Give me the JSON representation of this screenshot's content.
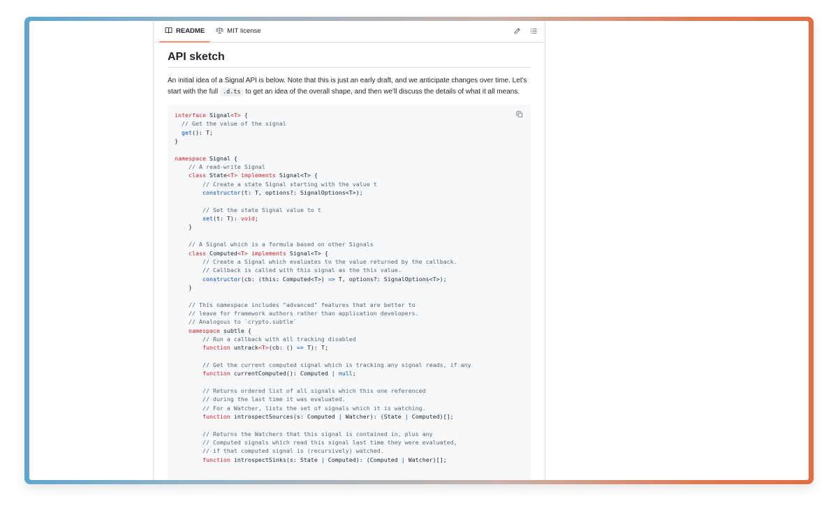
{
  "tabs": [
    {
      "label": "README",
      "icon": "book-icon",
      "active": true
    },
    {
      "label": "MIT license",
      "icon": "scale-icon",
      "active": false
    }
  ],
  "actions": [
    {
      "icon": "pencil-icon",
      "label": "Edit file"
    },
    {
      "icon": "list-icon",
      "label": "Outline"
    }
  ],
  "heading": "API sketch",
  "paragraph": {
    "before": "An initial idea of a Signal API is below. Note that this is just an early draft, and we anticipate changes over time. Let's start with the full ",
    "code": ".d.ts",
    "after": " to get an idea of the overall shape, and then we'll discuss the details of what it all means."
  },
  "code_lines": [
    [
      [
        "kw",
        "interface"
      ],
      [
        "tx",
        " Signal"
      ],
      [
        "kw",
        "<T>"
      ],
      [
        "tx",
        " {"
      ]
    ],
    [
      [
        "cm",
        "  // Get the value of the signal"
      ]
    ],
    [
      [
        "fn",
        "  get"
      ],
      [
        "tx",
        "(): T;"
      ]
    ],
    [
      [
        "tx",
        "}"
      ]
    ],
    [],
    [
      [
        "kw",
        "namespace"
      ],
      [
        "tx",
        " Signal {"
      ]
    ],
    [
      [
        "cm",
        "    // A read-write Signal"
      ]
    ],
    [
      [
        "kw",
        "    class"
      ],
      [
        "tx",
        " State"
      ],
      [
        "kw",
        "<T>"
      ],
      [
        "tx",
        " "
      ],
      [
        "kw",
        "implements"
      ],
      [
        "tx",
        " Signal<T> {"
      ]
    ],
    [
      [
        "cm",
        "        // Create a state Signal starting with the value t"
      ]
    ],
    [
      [
        "fn",
        "        constructor"
      ],
      [
        "tx",
        "(t: T, options?: SignalOptions<T>);"
      ]
    ],
    [],
    [
      [
        "cm",
        "        // Set the state Signal value to t"
      ]
    ],
    [
      [
        "fn",
        "        set"
      ],
      [
        "tx",
        "(t: T): "
      ],
      [
        "kw",
        "void"
      ],
      [
        "tx",
        ";"
      ]
    ],
    [
      [
        "tx",
        "    }"
      ]
    ],
    [],
    [
      [
        "cm",
        "    // A Signal which is a formula based on other Signals"
      ]
    ],
    [
      [
        "kw",
        "    class"
      ],
      [
        "tx",
        " Computed"
      ],
      [
        "kw",
        "<T>"
      ],
      [
        "tx",
        " "
      ],
      [
        "kw",
        "implements"
      ],
      [
        "tx",
        " Signal<T> {"
      ]
    ],
    [
      [
        "cm",
        "        // Create a Signal which evaluates to the value returned by the callback."
      ]
    ],
    [
      [
        "cm",
        "        // Callback is called with this signal as the this value."
      ]
    ],
    [
      [
        "fn",
        "        constructor"
      ],
      [
        "tx",
        "(cb: (this: Computed<T>) "
      ],
      [
        "op",
        "=>"
      ],
      [
        "tx",
        " T, options?: SignalOptions<T>);"
      ]
    ],
    [
      [
        "tx",
        "    }"
      ]
    ],
    [],
    [
      [
        "cm",
        "    // This namespace includes \"advanced\" features that are better to"
      ]
    ],
    [
      [
        "cm",
        "    // leave for framework authors rather than application developers."
      ]
    ],
    [
      [
        "cm",
        "    // Analogous to `crypto.subtle`"
      ]
    ],
    [
      [
        "kw",
        "    namespace"
      ],
      [
        "tx",
        " subtle {"
      ]
    ],
    [
      [
        "cm",
        "        // Run a callback with all tracking disabled"
      ]
    ],
    [
      [
        "kw",
        "        function"
      ],
      [
        "tx",
        " untrack"
      ],
      [
        "kw",
        "<T>"
      ],
      [
        "tx",
        "(cb: () "
      ],
      [
        "op",
        "=>"
      ],
      [
        "tx",
        " T): T;"
      ]
    ],
    [],
    [
      [
        "cm",
        "        // Get the current computed signal which is tracking any signal reads, if any"
      ]
    ],
    [
      [
        "kw",
        "        function"
      ],
      [
        "tx",
        " currentComputed(): Computed "
      ],
      [
        "op",
        "|"
      ],
      [
        "tx",
        " "
      ],
      [
        "fn",
        "null"
      ],
      [
        "tx",
        ";"
      ]
    ],
    [],
    [
      [
        "cm",
        "        // Returns ordered list of all signals which this one referenced"
      ]
    ],
    [
      [
        "cm",
        "        // during the last time it was evaluated."
      ]
    ],
    [
      [
        "cm",
        "        // For a Watcher, lists the set of signals which it is watching."
      ]
    ],
    [
      [
        "kw",
        "        function"
      ],
      [
        "tx",
        " introspectSources(s: Computed "
      ],
      [
        "op",
        "|"
      ],
      [
        "tx",
        " Watcher): (State "
      ],
      [
        "op",
        "|"
      ],
      [
        "tx",
        " Computed)[];"
      ]
    ],
    [],
    [
      [
        "cm",
        "        // Returns the Watchers that this signal is contained in, plus any"
      ]
    ],
    [
      [
        "cm",
        "        // Computed signals which read this signal last time they were evaluated,"
      ]
    ],
    [
      [
        "cm",
        "        // if that computed signal is (recursively) watched."
      ]
    ],
    [
      [
        "kw",
        "        function"
      ],
      [
        "tx",
        " introspectSinks(s: State "
      ],
      [
        "op",
        "|"
      ],
      [
        "tx",
        " Computed): (Computed "
      ],
      [
        "op",
        "|"
      ],
      [
        "tx",
        " Watcher)[];"
      ]
    ]
  ],
  "colors": {
    "keyword": "#cf222e",
    "comment": "#59636e",
    "function": "#0550ae",
    "active_tab_underline": "#fd8c73",
    "frame_gradient_left": "#5fa6cf",
    "frame_gradient_right": "#e26d45"
  }
}
